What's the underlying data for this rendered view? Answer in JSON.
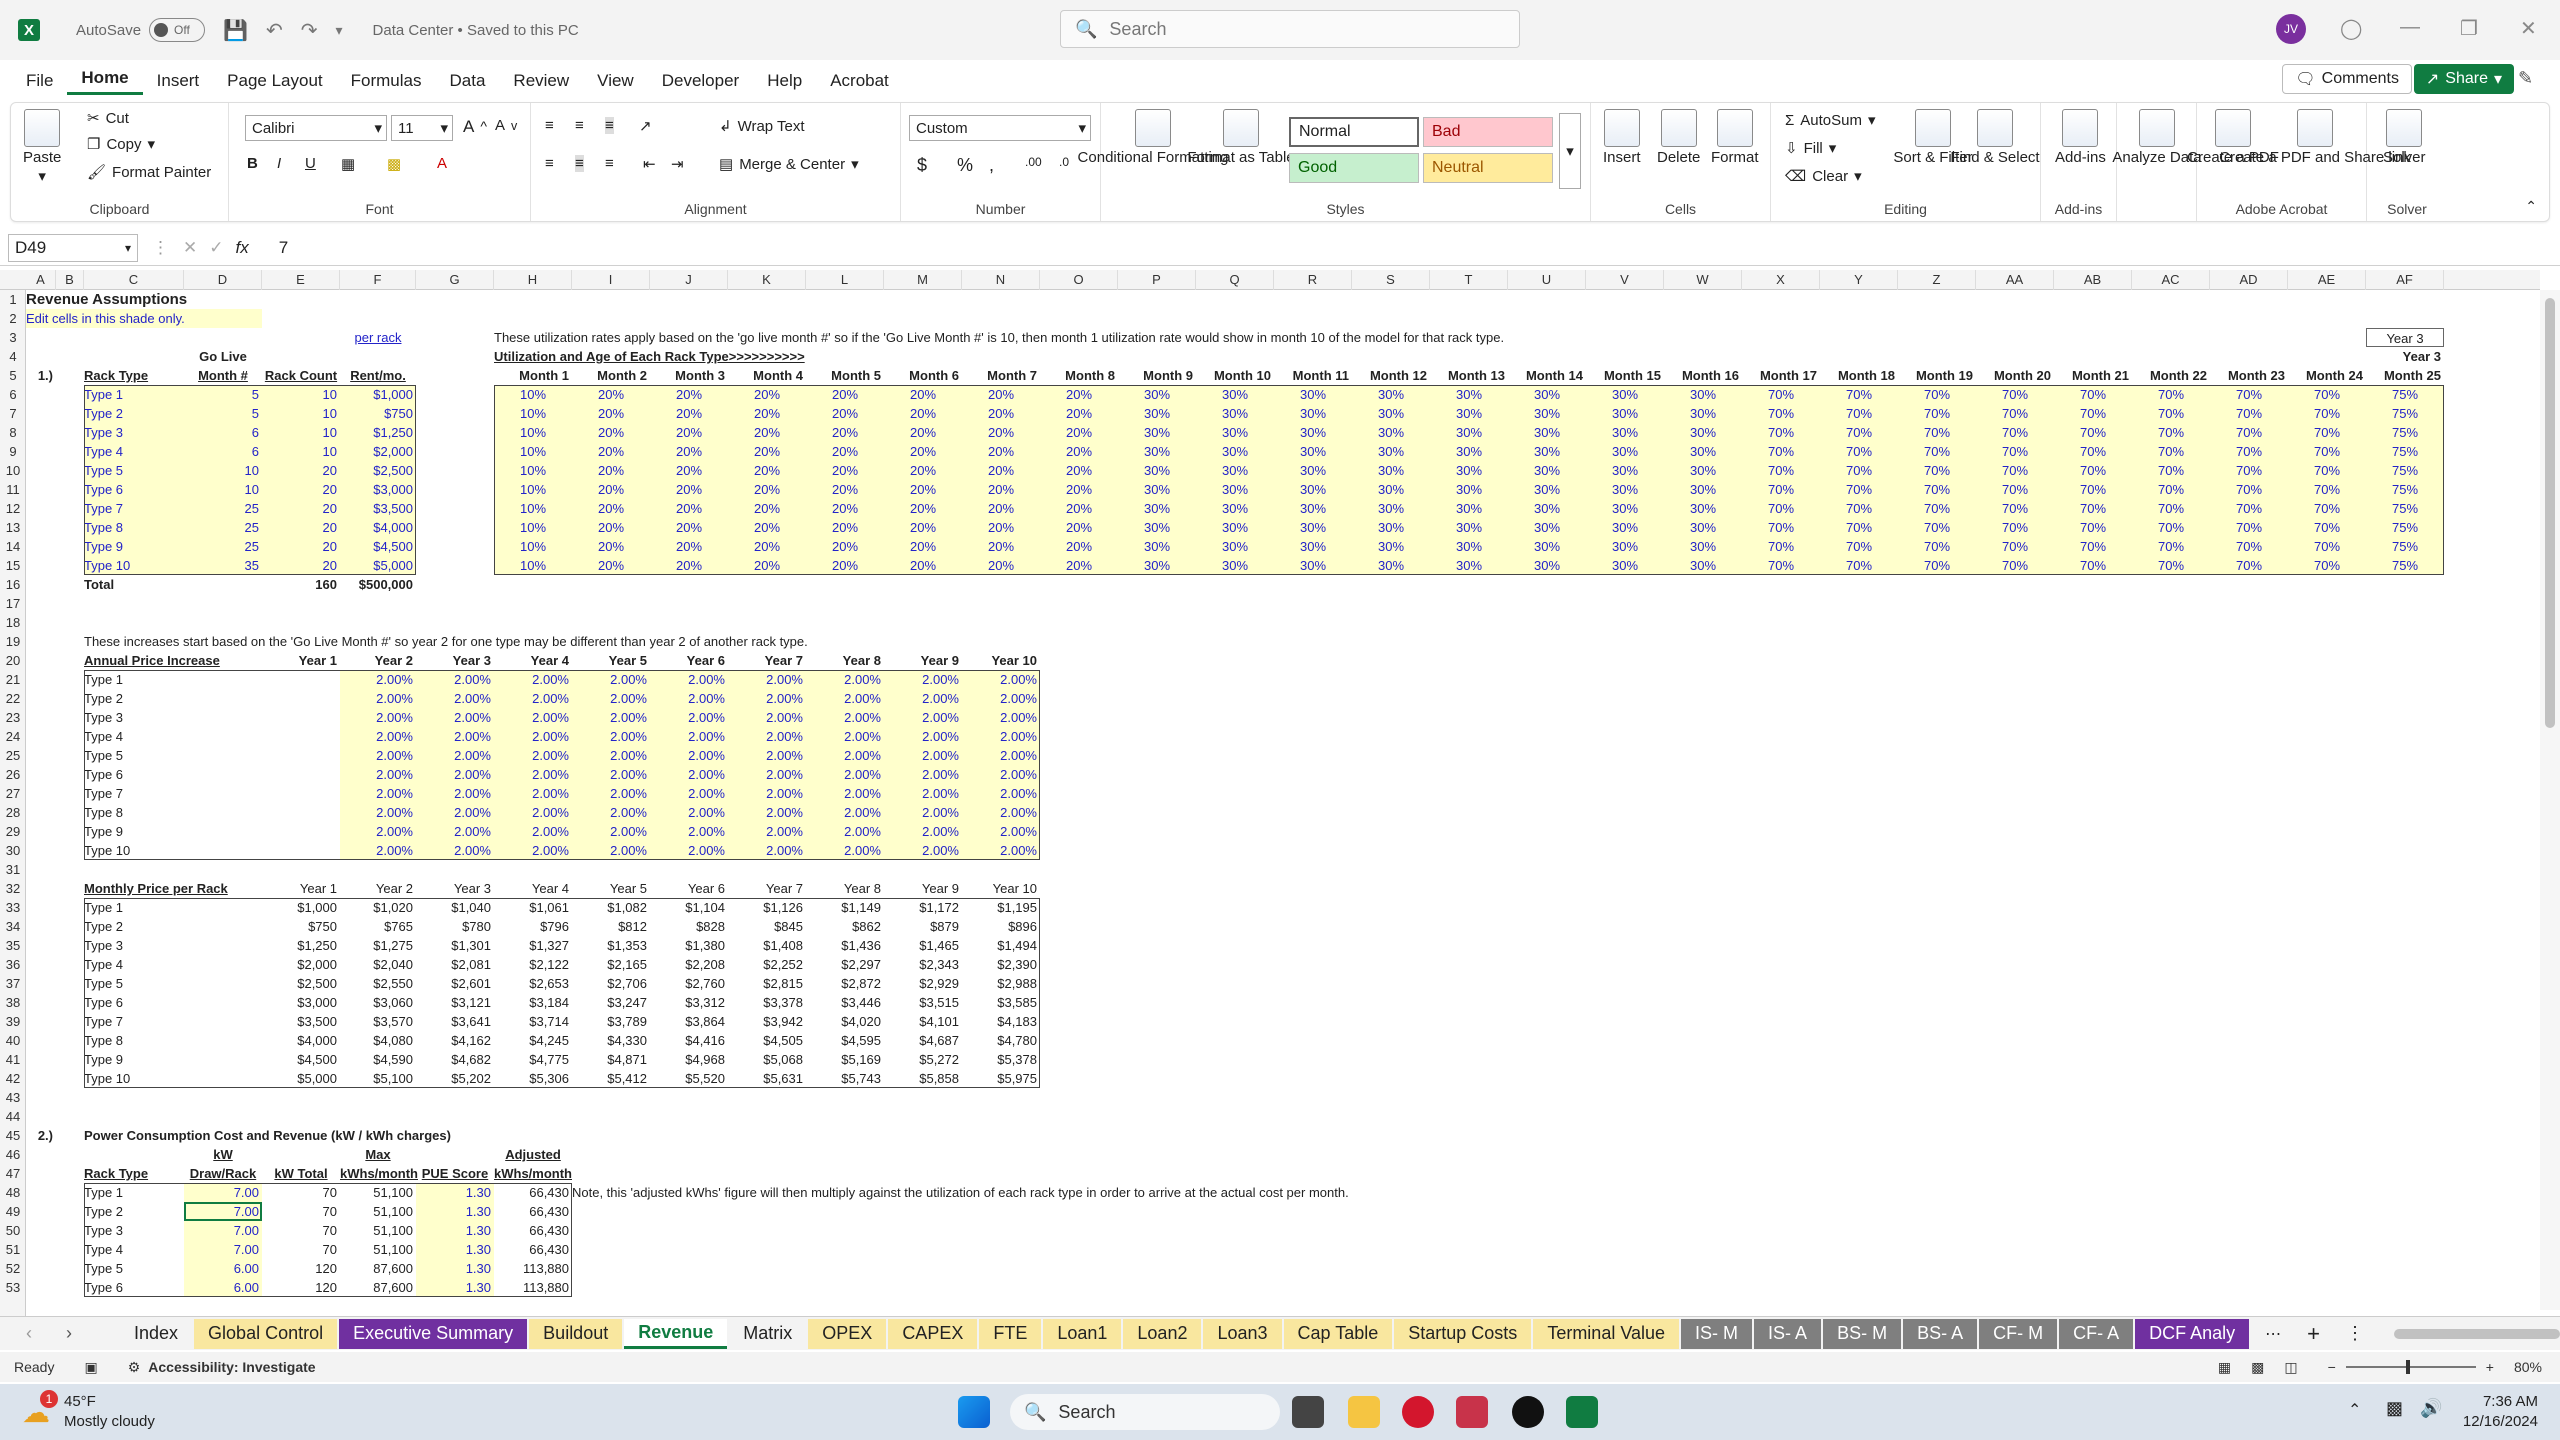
{
  "titlebar": {
    "autosave": "AutoSave",
    "autosave_state": "Off",
    "doc_title": "Data Center • Saved to this PC",
    "search_placeholder": "Search",
    "user_initials": "JV"
  },
  "menu": [
    "File",
    "Home",
    "Insert",
    "Page Layout",
    "Formulas",
    "Data",
    "Review",
    "View",
    "Developer",
    "Help",
    "Acrobat"
  ],
  "menu_active": "Home",
  "comments_label": "Comments",
  "share_label": "Share",
  "ribbon": {
    "clipboard": {
      "paste": "Paste",
      "cut": "Cut",
      "copy": "Copy",
      "format_painter": "Format Painter",
      "label": "Clipboard"
    },
    "font": {
      "name": "Calibri",
      "size": "11",
      "label": "Font"
    },
    "alignment": {
      "wrap": "Wrap Text",
      "merge": "Merge & Center",
      "label": "Alignment"
    },
    "number": {
      "format": "Custom",
      "label": "Number"
    },
    "styles": {
      "conditional": "Conditional Formatting",
      "format_table": "Format as Table",
      "normal": "Normal",
      "bad": "Bad",
      "good": "Good",
      "neutral": "Neutral",
      "label": "Styles"
    },
    "cells": {
      "insert": "Insert",
      "delete": "Delete",
      "format": "Format",
      "label": "Cells"
    },
    "editing": {
      "autosum": "AutoSum",
      "fill": "Fill",
      "clear": "Clear",
      "sort": "Sort & Filter",
      "find": "Find & Select",
      "label": "Editing"
    },
    "addins": {
      "addins": "Add-ins",
      "label": "Add-ins"
    },
    "analyze": {
      "label": "Analyze Data"
    },
    "acrobat": {
      "create_pdf": "Create a PDF",
      "create_share": "Create a PDF and Share link",
      "label": "Adobe Acrobat"
    },
    "solver": {
      "solver": "Solver",
      "label": "Solver"
    }
  },
  "formula": {
    "namebox": "D49",
    "value": "7"
  },
  "columns": [
    "A",
    "B",
    "C",
    "D",
    "E",
    "F",
    "G",
    "H",
    "I",
    "J",
    "K",
    "L",
    "M",
    "N",
    "O",
    "P",
    "Q",
    "R",
    "S",
    "T",
    "U",
    "V",
    "W",
    "X",
    "Y",
    "Z",
    "AA",
    "AB",
    "AC",
    "AD",
    "AE",
    "AF"
  ],
  "rows": [
    "1",
    "2",
    "3",
    "4",
    "5",
    "6",
    "7",
    "8",
    "9",
    "10",
    "11",
    "12",
    "13",
    "14",
    "15",
    "16",
    "17",
    "18",
    "19",
    "20",
    "21",
    "22",
    "23",
    "24",
    "25",
    "26",
    "27",
    "28",
    "29",
    "30",
    "31",
    "32",
    "33",
    "34",
    "35",
    "36",
    "37",
    "38",
    "39",
    "40",
    "41",
    "42",
    "43",
    "44",
    "45",
    "46",
    "47",
    "48",
    "49",
    "50",
    "51",
    "52",
    "53"
  ],
  "sheet": {
    "title": "Revenue Assumptions",
    "edit_note": "Edit cells in this shade only.",
    "per_rack": "per rack",
    "note_util": "These utilization rates apply based on the 'go live month #' so if the 'Go Live Month #' is 10, then month 1 utilization rate would show in month 10 of the model for that rack type.",
    "util_header": "Utilization and Age of Each Rack Type>>>>>>>>>>",
    "year3": "Year 3",
    "s1": "1.)",
    "h_rack_type": "Rack Type",
    "h_go_live": "Go Live",
    "h_month_num": "Month #",
    "h_rack_count": "Rack Count",
    "h_rent": "Rent/mo.",
    "months": [
      "Month 1",
      "Month 2",
      "Month 3",
      "Month 4",
      "Month 5",
      "Month 6",
      "Month 7",
      "Month 8",
      "Month 9",
      "Month 10",
      "Month 11",
      "Month 12",
      "Month 13",
      "Month 14",
      "Month 15",
      "Month 16",
      "Month 17",
      "Month 18",
      "Month 19",
      "Month 20",
      "Month 21",
      "Month 22",
      "Month 23",
      "Month 24",
      "Month 25"
    ],
    "util_row": [
      "10%",
      "20%",
      "20%",
      "20%",
      "20%",
      "20%",
      "20%",
      "20%",
      "30%",
      "30%",
      "30%",
      "30%",
      "30%",
      "30%",
      "30%",
      "30%",
      "70%",
      "70%",
      "70%",
      "70%",
      "70%",
      "70%",
      "70%",
      "70%",
      "75%"
    ],
    "racks": [
      {
        "type": "Type 1",
        "golive": "5",
        "count": "10",
        "rent": "$1,000"
      },
      {
        "type": "Type 2",
        "golive": "5",
        "count": "10",
        "rent": "$750"
      },
      {
        "type": "Type 3",
        "golive": "6",
        "count": "10",
        "rent": "$1,250"
      },
      {
        "type": "Type 4",
        "golive": "6",
        "count": "10",
        "rent": "$2,000"
      },
      {
        "type": "Type 5",
        "golive": "10",
        "count": "20",
        "rent": "$2,500"
      },
      {
        "type": "Type 6",
        "golive": "10",
        "count": "20",
        "rent": "$3,000"
      },
      {
        "type": "Type 7",
        "golive": "25",
        "count": "20",
        "rent": "$3,500"
      },
      {
        "type": "Type 8",
        "golive": "25",
        "count": "20",
        "rent": "$4,000"
      },
      {
        "type": "Type 9",
        "golive": "25",
        "count": "20",
        "rent": "$4,500"
      },
      {
        "type": "Type 10",
        "golive": "35",
        "count": "20",
        "rent": "$5,000"
      }
    ],
    "total_label": "Total",
    "total_count": "160",
    "total_rent": "$500,000",
    "note_price": "These increases start based on the 'Go Live Month #' so year 2 for one type may be different than year 2 of another rack type.",
    "api_label": "Annual Price Increase",
    "years": [
      "Year 1",
      "Year 2",
      "Year 3",
      "Year 4",
      "Year 5",
      "Year 6",
      "Year 7",
      "Year 8",
      "Year 9",
      "Year 10"
    ],
    "api_value": "2.00%",
    "types": [
      "Type 1",
      "Type 2",
      "Type 3",
      "Type 4",
      "Type 5",
      "Type 6",
      "Type 7",
      "Type 8",
      "Type 9",
      "Type 10"
    ],
    "mpr_label": "Monthly Price per Rack",
    "mpr": [
      [
        "$1,000",
        "$1,020",
        "$1,040",
        "$1,061",
        "$1,082",
        "$1,104",
        "$1,126",
        "$1,149",
        "$1,172",
        "$1,195"
      ],
      [
        "$750",
        "$765",
        "$780",
        "$796",
        "$812",
        "$828",
        "$845",
        "$862",
        "$879",
        "$896"
      ],
      [
        "$1,250",
        "$1,275",
        "$1,301",
        "$1,327",
        "$1,353",
        "$1,380",
        "$1,408",
        "$1,436",
        "$1,465",
        "$1,494"
      ],
      [
        "$2,000",
        "$2,040",
        "$2,081",
        "$2,122",
        "$2,165",
        "$2,208",
        "$2,252",
        "$2,297",
        "$2,343",
        "$2,390"
      ],
      [
        "$2,500",
        "$2,550",
        "$2,601",
        "$2,653",
        "$2,706",
        "$2,760",
        "$2,815",
        "$2,872",
        "$2,929",
        "$2,988"
      ],
      [
        "$3,000",
        "$3,060",
        "$3,121",
        "$3,184",
        "$3,247",
        "$3,312",
        "$3,378",
        "$3,446",
        "$3,515",
        "$3,585"
      ],
      [
        "$3,500",
        "$3,570",
        "$3,641",
        "$3,714",
        "$3,789",
        "$3,864",
        "$3,942",
        "$4,020",
        "$4,101",
        "$4,183"
      ],
      [
        "$4,000",
        "$4,080",
        "$4,162",
        "$4,245",
        "$4,330",
        "$4,416",
        "$4,505",
        "$4,595",
        "$4,687",
        "$4,780"
      ],
      [
        "$4,500",
        "$4,590",
        "$4,682",
        "$4,775",
        "$4,871",
        "$4,968",
        "$5,068",
        "$5,169",
        "$5,272",
        "$5,378"
      ],
      [
        "$5,000",
        "$5,100",
        "$5,202",
        "$5,306",
        "$5,412",
        "$5,520",
        "$5,631",
        "$5,743",
        "$5,858",
        "$5,975"
      ]
    ],
    "s2": "2.)",
    "power_title": "Power Consumption Cost and Revenue (kW / kWh charges)",
    "p_rack_type": "Rack Type",
    "p_kw": "kW",
    "p_draw": "Draw/Rack",
    "p_kwtotal": "kW Total",
    "p_max": "Max",
    "p_kwh": "kWhs/month",
    "p_pue": "PUE Score",
    "p_adj": "Adjusted",
    "p_adjkwh": "kWhs/month",
    "power_note": "Note, this 'adjusted kWhs' figure will then multiply against the utilization of each rack type in order to arrive at the actual cost per month.",
    "power": [
      [
        "Type 1",
        "7.00",
        "70",
        "51,100",
        "1.30",
        "66,430"
      ],
      [
        "Type 2",
        "7.00",
        "70",
        "51,100",
        "1.30",
        "66,430"
      ],
      [
        "Type 3",
        "7.00",
        "70",
        "51,100",
        "1.30",
        "66,430"
      ],
      [
        "Type 4",
        "7.00",
        "70",
        "51,100",
        "1.30",
        "66,430"
      ],
      [
        "Type 5",
        "6.00",
        "120",
        "87,600",
        "1.30",
        "113,880"
      ],
      [
        "Type 6",
        "6.00",
        "120",
        "87,600",
        "1.30",
        "113,880"
      ]
    ]
  },
  "tabs": [
    "Index",
    "Global Control",
    "Executive Summary",
    "Buildout",
    "Revenue",
    "Matrix",
    "OPEX",
    "CAPEX",
    "FTE",
    "Loan1",
    "Loan2",
    "Loan3",
    "Cap Table",
    "Startup Costs",
    "Terminal Value",
    "IS- M",
    "IS- A",
    "BS- M",
    "BS- A",
    "CF- M",
    "CF- A",
    "DCF Analy"
  ],
  "tab_active": "Revenue",
  "status": {
    "ready": "Ready",
    "accessibility": "Accessibility: Investigate",
    "zoom": "80%"
  },
  "taskbar": {
    "temp": "45°F",
    "weather": "Mostly cloudy",
    "search": "Search",
    "time": "7:36 AM",
    "date": "12/16/2024",
    "badge": "1"
  }
}
